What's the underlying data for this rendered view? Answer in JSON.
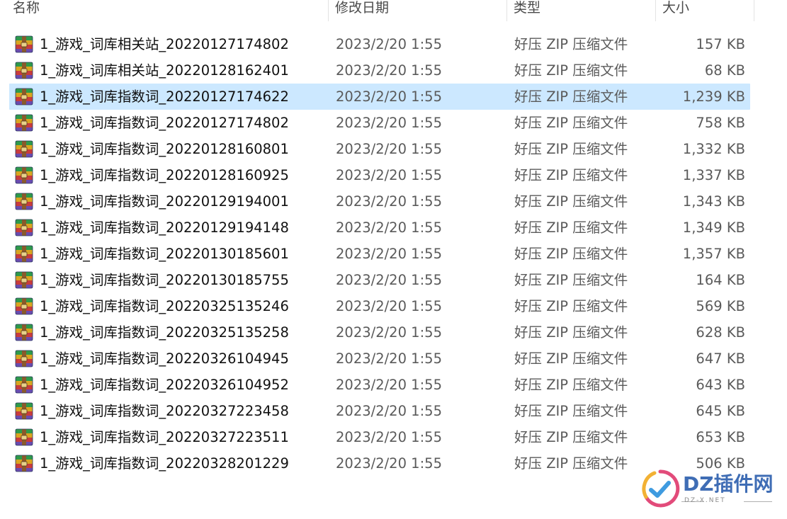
{
  "columns": {
    "name": "名称",
    "date": "修改日期",
    "type": "类型",
    "size": "大小"
  },
  "files": [
    {
      "name": "1_游戏_词库相关站_20220127174802",
      "date": "2023/2/20 1:55",
      "type": "好压 ZIP 压缩文件",
      "size": "157 KB"
    },
    {
      "name": "1_游戏_词库相关站_20220128162401",
      "date": "2023/2/20 1:55",
      "type": "好压 ZIP 压缩文件",
      "size": "68 KB"
    },
    {
      "name": "1_游戏_词库指数词_20220127174622",
      "date": "2023/2/20 1:55",
      "type": "好压 ZIP 压缩文件",
      "size": "1,239 KB",
      "selected": true
    },
    {
      "name": "1_游戏_词库指数词_20220127174802",
      "date": "2023/2/20 1:55",
      "type": "好压 ZIP 压缩文件",
      "size": "758 KB"
    },
    {
      "name": "1_游戏_词库指数词_20220128160801",
      "date": "2023/2/20 1:55",
      "type": "好压 ZIP 压缩文件",
      "size": "1,332 KB"
    },
    {
      "name": "1_游戏_词库指数词_20220128160925",
      "date": "2023/2/20 1:55",
      "type": "好压 ZIP 压缩文件",
      "size": "1,337 KB"
    },
    {
      "name": "1_游戏_词库指数词_20220129194001",
      "date": "2023/2/20 1:55",
      "type": "好压 ZIP 压缩文件",
      "size": "1,343 KB"
    },
    {
      "name": "1_游戏_词库指数词_20220129194148",
      "date": "2023/2/20 1:55",
      "type": "好压 ZIP 压缩文件",
      "size": "1,349 KB"
    },
    {
      "name": "1_游戏_词库指数词_20220130185601",
      "date": "2023/2/20 1:55",
      "type": "好压 ZIP 压缩文件",
      "size": "1,357 KB"
    },
    {
      "name": "1_游戏_词库指数词_20220130185755",
      "date": "2023/2/20 1:55",
      "type": "好压 ZIP 压缩文件",
      "size": "164 KB"
    },
    {
      "name": "1_游戏_词库指数词_20220325135246",
      "date": "2023/2/20 1:55",
      "type": "好压 ZIP 压缩文件",
      "size": "569 KB"
    },
    {
      "name": "1_游戏_词库指数词_20220325135258",
      "date": "2023/2/20 1:55",
      "type": "好压 ZIP 压缩文件",
      "size": "628 KB"
    },
    {
      "name": "1_游戏_词库指数词_20220326104945",
      "date": "2023/2/20 1:55",
      "type": "好压 ZIP 压缩文件",
      "size": "647 KB"
    },
    {
      "name": "1_游戏_词库指数词_20220326104952",
      "date": "2023/2/20 1:55",
      "type": "好压 ZIP 压缩文件",
      "size": "643 KB"
    },
    {
      "name": "1_游戏_词库指数词_20220327223458",
      "date": "2023/2/20 1:55",
      "type": "好压 ZIP 压缩文件",
      "size": "645 KB"
    },
    {
      "name": "1_游戏_词库指数词_20220327223511",
      "date": "2023/2/20 1:55",
      "type": "好压 ZIP 压缩文件",
      "size": "653 KB"
    },
    {
      "name": "1_游戏_词库指数词_20220328201229",
      "date": "2023/2/20 1:55",
      "type": "好压 ZIP 压缩文件",
      "size": "506 KB"
    }
  ],
  "icon": "archive-zip-icon",
  "colors": {
    "selection": "#cce8ff",
    "watermark": "#3f6db5"
  },
  "watermark": {
    "logo": "DZ插件网",
    "sub": "DZ-X.NET"
  }
}
